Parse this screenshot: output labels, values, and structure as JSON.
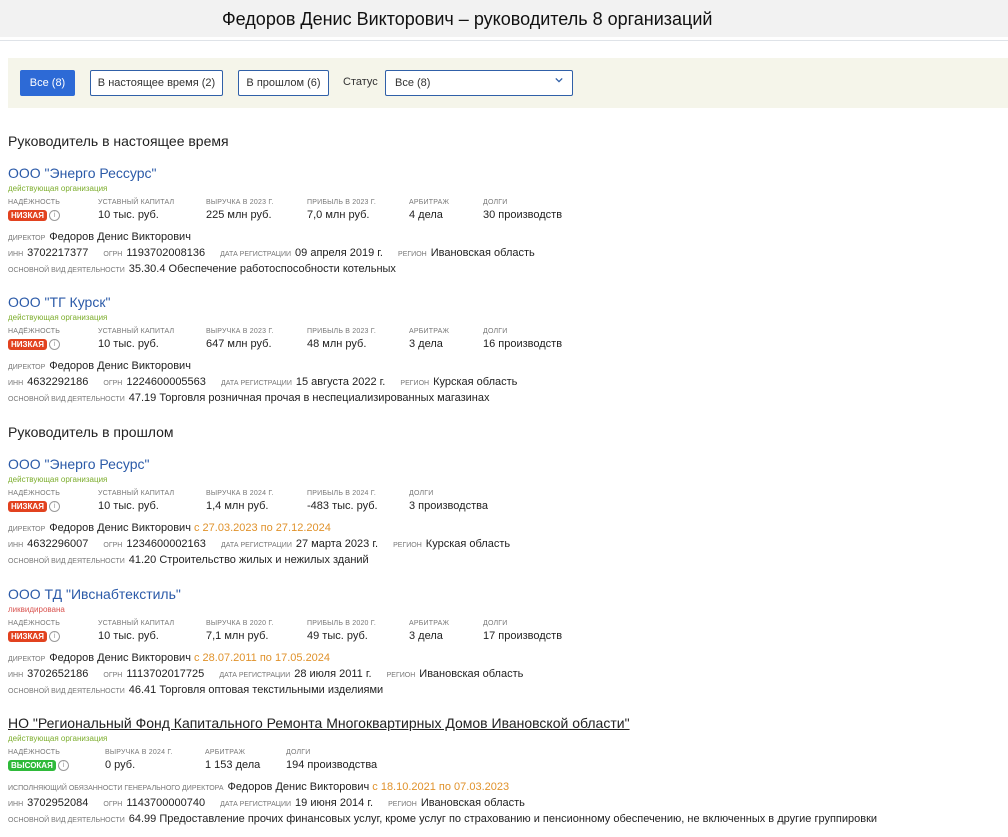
{
  "header": {
    "title": "Федоров Денис Викторович – руководитель 8 организаций"
  },
  "filters": {
    "buttons": [
      "Все (8)",
      "В настоящее время (2)",
      "В прошлом (6)"
    ],
    "status_label": "Статус",
    "status_value": "Все (8)"
  },
  "sections": {
    "current": "Руководитель в настоящее время",
    "past": "Руководитель в прошлом"
  },
  "labels": {
    "reliability": "надёжность",
    "capital": "уставный капитал",
    "arbitration": "арбитраж",
    "debts": "долги",
    "director": "директор",
    "inn": "инн",
    "ogrn": "огрн",
    "reg_date": "дата регистрации",
    "region": "регион",
    "activity": "основной вид деятельности",
    "acting": "исполняющий обязанности генерального директора"
  },
  "orgs": [
    {
      "name": "ООО \"Энерго Рессурс\"",
      "status": "действующая организация",
      "badge": "НИЗКАЯ",
      "capital": "10 тыс. руб.",
      "rev_label": "выручка в 2023 г.",
      "revenue": "225 млн руб.",
      "prof_label": "прибыль в 2023 г.",
      "profit": "7,0 млн руб.",
      "arbitration": "4 дела",
      "debts": "30 производств",
      "director": "Федоров Денис Викторович",
      "period": "",
      "inn": "3702217377",
      "ogrn": "1193702008136",
      "reg_date": "09 апреля 2019 г.",
      "region": "Ивановская область",
      "activity": "35.30.4 Обеспечение работоспособности котельных"
    },
    {
      "name": "ООО \"ТГ Курск\"",
      "status": "действующая организация",
      "badge": "НИЗКАЯ",
      "capital": "10 тыс. руб.",
      "rev_label": "выручка в 2023 г.",
      "revenue": "647 млн руб.",
      "prof_label": "прибыль в 2023 г.",
      "profit": "48 млн руб.",
      "arbitration": "3 дела",
      "debts": "16 производств",
      "director": "Федоров Денис Викторович",
      "period": "",
      "inn": "4632292186",
      "ogrn": "1224600005563",
      "reg_date": "15 августа 2022 г.",
      "region": "Курская область",
      "activity": "47.19 Торговля розничная прочая в неспециализированных магазинах"
    },
    {
      "name": "ООО \"Энерго Ресурс\"",
      "status": "действующая организация",
      "badge": "НИЗКАЯ",
      "capital": "10 тыс. руб.",
      "rev_label": "выручка в 2024 г.",
      "revenue": "1,4 млн руб.",
      "prof_label": "прибыль в 2024 г.",
      "profit": "-483 тыс. руб.",
      "arbitration": "",
      "debts": "3 производства",
      "director": "Федоров Денис Викторович",
      "period": "с 27.03.2023 по 27.12.2024",
      "inn": "4632296007",
      "ogrn": "1234600002163",
      "reg_date": "27 марта 2023 г.",
      "region": "Курская область",
      "activity": "41.20 Строительство жилых и нежилых зданий"
    },
    {
      "name": "ООО ТД \"Ивснабтекстиль\"",
      "status": "ликвидирована",
      "badge": "НИЗКАЯ",
      "capital": "10 тыс. руб.",
      "rev_label": "выручка в 2020 г.",
      "revenue": "7,1 млн руб.",
      "prof_label": "прибыль в 2020 г.",
      "profit": "49 тыс. руб.",
      "arbitration": "3 дела",
      "debts": "17 производств",
      "director": "Федоров Денис Викторович",
      "period": "с 28.07.2011 по 17.05.2024",
      "inn": "3702652186",
      "ogrn": "1113702017725",
      "reg_date": "28 июля 2011 г.",
      "region": "Ивановская область",
      "activity": "46.41 Торговля оптовая текстильными изделиями"
    },
    {
      "name": "НО \"Региональный Фонд Капитального Ремонта Многоквартирных Домов Ивановской области\"",
      "status": "действующая организация",
      "badge": "ВЫСОКАЯ",
      "rev_label": "выручка в 2024 г.",
      "revenue": "0 руб.",
      "arbitration": "1 153 дела",
      "debts": "194 производства",
      "director": "Федоров Денис Викторович",
      "period": "с 18.10.2021 по 07.03.2023",
      "inn": "3702952084",
      "ogrn": "1143700000740",
      "reg_date": "19 июня 2014 г.",
      "region": "Ивановская область",
      "activity": "64.99 Предоставление прочих финансовых услуг, кроме услуг по страхованию и пенсионному обеспечению, не включенных в другие группировки"
    }
  ]
}
